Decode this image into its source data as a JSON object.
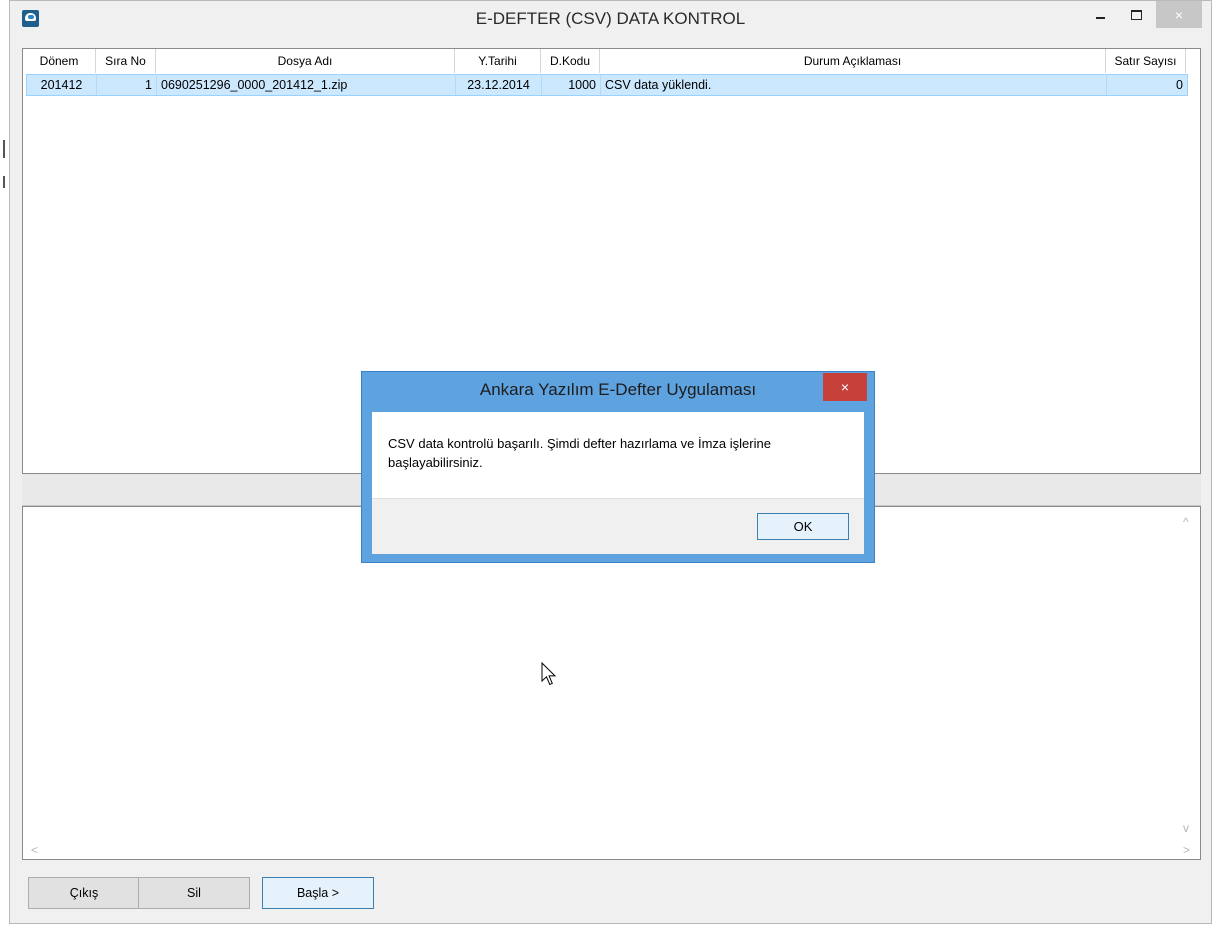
{
  "window": {
    "title": "E-DEFTER (CSV) DATA KONTROL",
    "controls": {
      "minimize": "minimize",
      "maximize": "maximize",
      "close": "×"
    }
  },
  "grid": {
    "columns": [
      "Dönem",
      "Sıra No",
      "Dosya Adı",
      "Y.Tarihi",
      "D.Kodu",
      "Durum Açıklaması",
      "Satır Sayısı"
    ],
    "rows": [
      {
        "donem": "201412",
        "sira_no": "1",
        "dosya_adi": "0690251296_0000_201412_1.zip",
        "y_tarihi": "23.12.2014",
        "d_kodu": "1000",
        "durum": "CSV data yüklendi.",
        "satir_sayisi": "0"
      }
    ]
  },
  "lower_panel": {
    "scroll_up": "^",
    "scroll_down": "v",
    "scroll_left": "<",
    "scroll_right": ">"
  },
  "buttons": {
    "exit": "Çıkış",
    "delete": "Sil",
    "start": "Başla >"
  },
  "dialog": {
    "title": "Ankara Yazılım E-Defter Uygulaması",
    "close": "×",
    "message": "CSV data kontrolü başarılı. Şimdi defter hazırlama ve İmza işlerine başlayabilirsiniz.",
    "ok": "OK"
  },
  "colors": {
    "selection": "#cce8ff",
    "dialog_frame": "#5ea2df",
    "dialog_close": "#c7413b"
  }
}
